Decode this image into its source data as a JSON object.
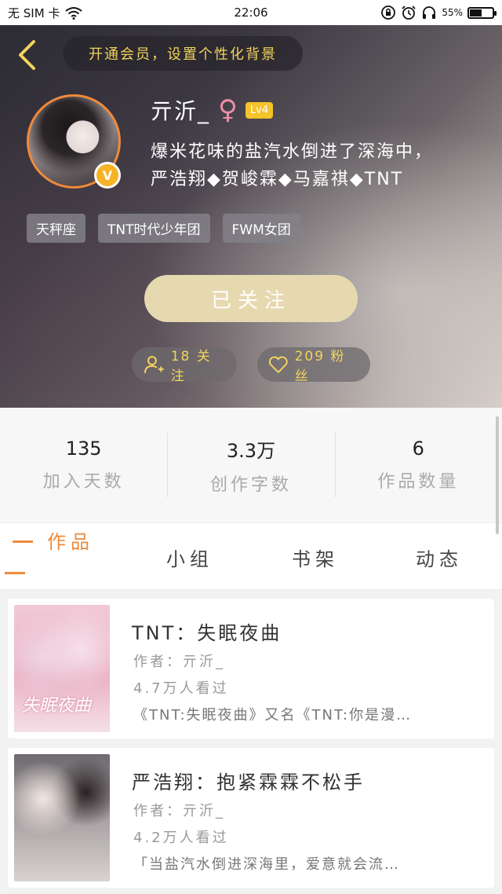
{
  "status_bar": {
    "carrier": "无 SIM 卡",
    "time": "22:06",
    "battery": "55%",
    "battery_level": 0.55,
    "icons": [
      "wifi-icon",
      "lock-rotation-icon",
      "alarm-icon",
      "headphones-icon",
      "battery-icon"
    ]
  },
  "header": {
    "vip_banner": "开通会员，设置个性化背景",
    "username": "亓沂_",
    "gender_symbol": "♀",
    "level": "Lv4",
    "verified_badge": "V",
    "bio_line1": "爆米花味的盐汽水倒进了深海中，",
    "bio_line2": "严浩翔◆贺峻霖◆马嘉祺◆TNT",
    "tags": [
      "天秤座",
      "TNT时代少年团",
      "FWM女团"
    ],
    "follow_button": "已关注",
    "following": "18 关注",
    "fans": "209 粉丝"
  },
  "stats": [
    {
      "value": "135",
      "label": "加入天数"
    },
    {
      "value": "3.3万",
      "label": "创作字数"
    },
    {
      "value": "6",
      "label": "作品数量"
    }
  ],
  "tabs": [
    "作品",
    "小组",
    "书架",
    "动态"
  ],
  "works": [
    {
      "cover_text": "失眠夜曲",
      "title": "TNT：失眠夜曲",
      "author": "作者：亓沂_",
      "views": "4.7万人看过",
      "description": "《TNT:失眠夜曲》又名《TNT:你是漫…"
    },
    {
      "cover_text": "",
      "title": "严浩翔：抱紧霖霖不松手",
      "author": "作者：亓沂_",
      "views": "4.2万人看过",
      "description": "「当盐汽水倒进深海里，爱意就会流…"
    }
  ],
  "colors": {
    "accent": "#f08a3a",
    "gold": "#f2d35c",
    "follow_button": "#e6d9b0"
  }
}
